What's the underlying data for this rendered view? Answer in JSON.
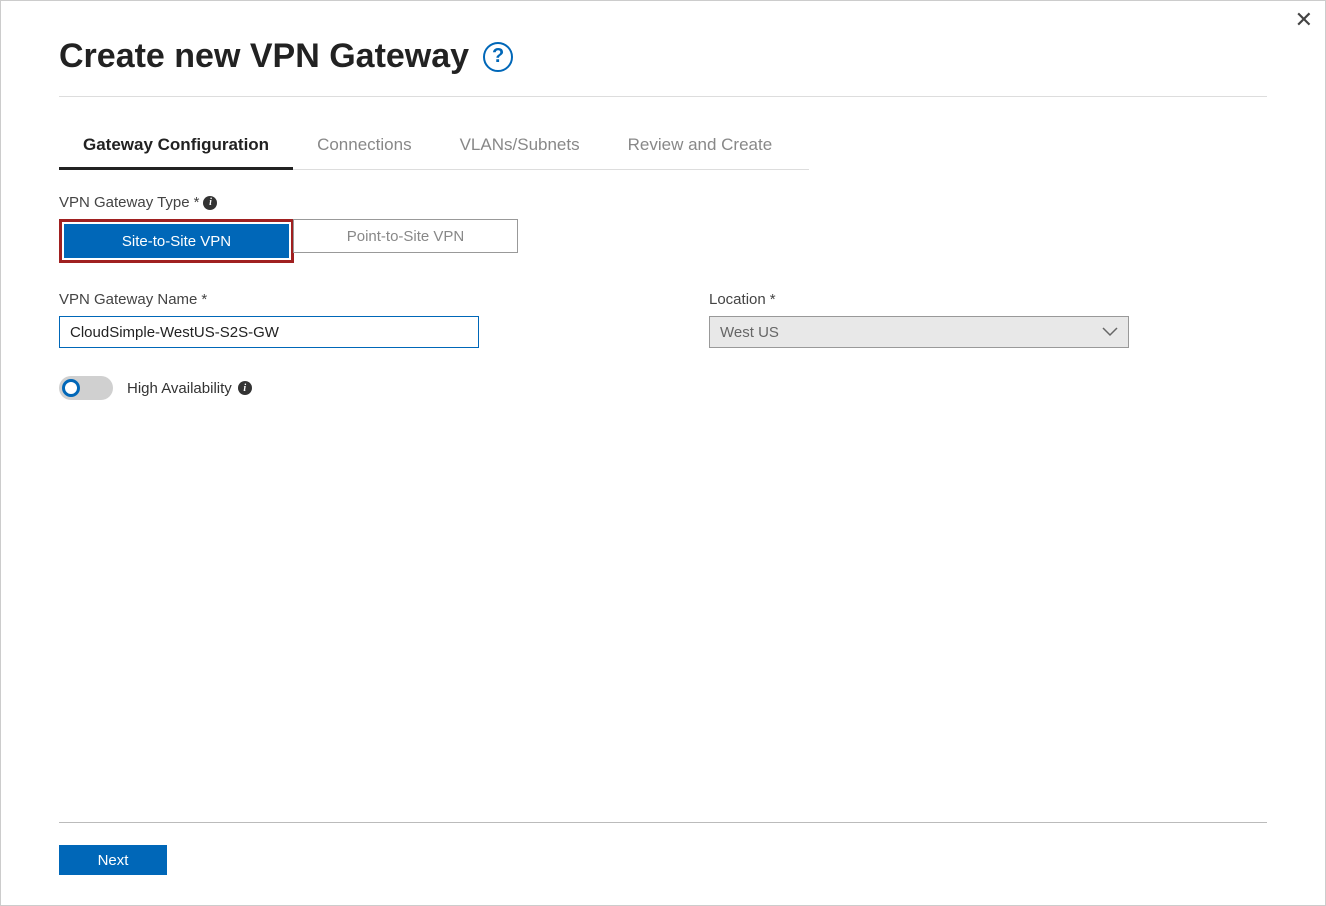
{
  "header": {
    "title": "Create new VPN Gateway",
    "help_tooltip": "?"
  },
  "tabs": [
    {
      "label": "Gateway Configuration",
      "active": true
    },
    {
      "label": "Connections",
      "active": false
    },
    {
      "label": "VLANs/Subnets",
      "active": false
    },
    {
      "label": "Review and Create",
      "active": false
    }
  ],
  "form": {
    "type_label": "VPN Gateway Type",
    "type_options": [
      {
        "label": "Site-to-Site VPN",
        "selected": true
      },
      {
        "label": "Point-to-Site VPN",
        "selected": false
      }
    ],
    "name_label": "VPN Gateway Name",
    "name_value": "CloudSimple-WestUS-S2S-GW",
    "location_label": "Location",
    "location_value": "West US",
    "ha_label": "High Availability",
    "ha_enabled": false
  },
  "footer": {
    "next_label": "Next"
  }
}
